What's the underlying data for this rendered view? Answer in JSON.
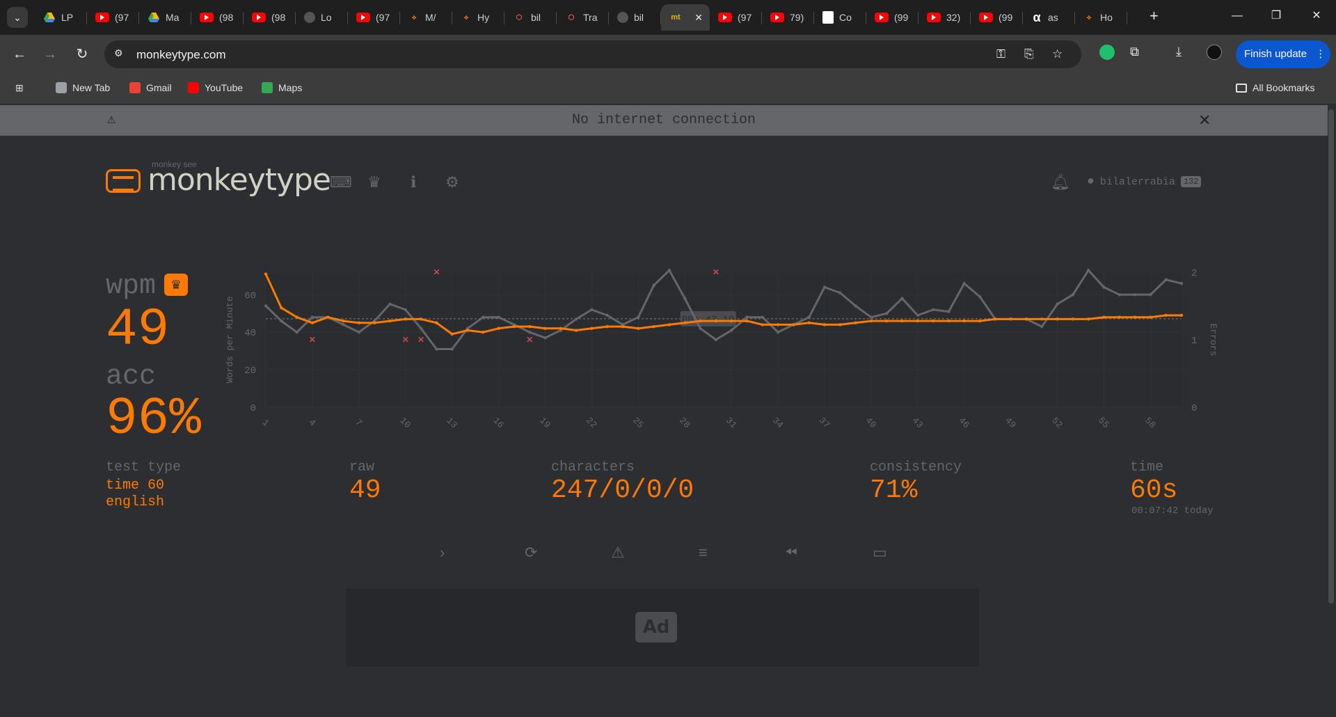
{
  "browser": {
    "tabs": [
      {
        "label": "LP",
        "icon": "drive"
      },
      {
        "label": "(97",
        "icon": "youtube"
      },
      {
        "label": "Ma",
        "icon": "drive"
      },
      {
        "label": "(98",
        "icon": "youtube"
      },
      {
        "label": "(98",
        "icon": "youtube"
      },
      {
        "label": "Lo",
        "icon": "plain"
      },
      {
        "label": "(97",
        "icon": "youtube"
      },
      {
        "label": "M/",
        "icon": "bee"
      },
      {
        "label": "Hy",
        "icon": "bee"
      },
      {
        "label": "bil",
        "icon": "red"
      },
      {
        "label": "Tra",
        "icon": "red"
      },
      {
        "label": "bil",
        "icon": "plain"
      },
      {
        "label": "mt",
        "icon": "mt",
        "active": true
      },
      {
        "label": "(97",
        "icon": "youtube"
      },
      {
        "label": "79)",
        "icon": "youtube"
      },
      {
        "label": "Co",
        "icon": "doc"
      },
      {
        "label": "(99",
        "icon": "youtube"
      },
      {
        "label": "32)",
        "icon": "youtube"
      },
      {
        "label": "(99",
        "icon": "youtube"
      },
      {
        "label": "as",
        "icon": "alpha"
      },
      {
        "label": "Ho",
        "icon": "bee"
      }
    ],
    "url": "monkeytype.com",
    "finish_update": "Finish update",
    "bookmarks": [
      {
        "label": "New Tab",
        "color": "#9aa0a6"
      },
      {
        "label": "Gmail",
        "color": "#ea4335"
      },
      {
        "label": "YouTube",
        "color": "#ff0000"
      },
      {
        "label": "Maps",
        "color": "#34a853"
      }
    ],
    "all_bookmarks": "All Bookmarks"
  },
  "page": {
    "offline_message": "No internet connection",
    "logo": {
      "sub": "monkey see",
      "title": "monkeytype"
    },
    "user": {
      "name": "bilalerrabia",
      "level": "132"
    },
    "stats": {
      "wpm_label": "wpm",
      "wpm_value": "49",
      "acc_label": "acc",
      "acc_value": "96%",
      "test_type_label": "test type",
      "test_type_line1": "time 60",
      "test_type_line2": "english",
      "raw_label": "raw",
      "raw_value": "49",
      "characters_label": "characters",
      "characters_value": "247/0/0/0",
      "consistency_label": "consistency",
      "consistency_value": "71%",
      "time_label": "time",
      "time_value": "60s",
      "time_detail": "00:07:42 today"
    },
    "ad_label": "Ad"
  },
  "colors": {
    "accent": "#ff7a00",
    "sub": "#646669",
    "text": "#d1d0c5",
    "bg": "#2c2e31",
    "error": "#ca4754"
  },
  "chart_data": {
    "type": "line",
    "ylabel": "Words per Minute",
    "y2label": "Errors",
    "ylim": [
      0,
      72
    ],
    "y2lim": [
      0,
      2
    ],
    "yticks": [
      "0",
      "20",
      "40",
      "60"
    ],
    "y2ticks": [
      "0",
      "1",
      "2"
    ],
    "xticks": [
      "1",
      "4",
      "7",
      "10",
      "13",
      "16",
      "19",
      "22",
      "25",
      "28",
      "31",
      "34",
      "37",
      "40",
      "43",
      "46",
      "49",
      "52",
      "55",
      "58"
    ],
    "pb_label": "PB: 47.19",
    "pb_value": 47.19,
    "x": [
      1,
      2,
      3,
      4,
      5,
      6,
      7,
      8,
      9,
      10,
      11,
      12,
      13,
      14,
      15,
      16,
      17,
      18,
      19,
      20,
      21,
      22,
      23,
      24,
      25,
      26,
      27,
      28,
      29,
      30,
      31,
      32,
      33,
      34,
      35,
      36,
      37,
      38,
      39,
      40,
      41,
      42,
      43,
      44,
      45,
      46,
      47,
      48,
      49,
      50,
      51,
      52,
      53,
      54,
      55,
      56,
      57,
      58,
      59,
      60
    ],
    "series": [
      {
        "name": "wpm",
        "color": "#ff7a00",
        "values": [
          71,
          53,
          48,
          45,
          48,
          46,
          45,
          45,
          46,
          47,
          47,
          45,
          39,
          41,
          40,
          42,
          43,
          43,
          42,
          42,
          41,
          42,
          43,
          43,
          42,
          43,
          44,
          45,
          46,
          46,
          46,
          46,
          44,
          44,
          44,
          45,
          44,
          44,
          45,
          46,
          46,
          46,
          46,
          46,
          46,
          46,
          46,
          47,
          47,
          47,
          47,
          47,
          47,
          47,
          48,
          48,
          48,
          48,
          49,
          49
        ]
      },
      {
        "name": "raw",
        "color": "#646669",
        "values": [
          54,
          46,
          40,
          48,
          48,
          44,
          40,
          46,
          55,
          52,
          42,
          31,
          31,
          42,
          48,
          48,
          44,
          40,
          37,
          41,
          47,
          52,
          49,
          44,
          48,
          65,
          73,
          58,
          42,
          36,
          41,
          48,
          48,
          40,
          44,
          48,
          64,
          61,
          54,
          48,
          50,
          58,
          49,
          52,
          51,
          66,
          59,
          47,
          47,
          47,
          43,
          55,
          60,
          73,
          64,
          60,
          60,
          60,
          68,
          66
        ]
      }
    ],
    "errors": [
      {
        "x": 4,
        "y": 1
      },
      {
        "x": 10,
        "y": 1
      },
      {
        "x": 11,
        "y": 1
      },
      {
        "x": 12,
        "y": 2
      },
      {
        "x": 18,
        "y": 1
      },
      {
        "x": 30,
        "y": 2
      }
    ]
  }
}
